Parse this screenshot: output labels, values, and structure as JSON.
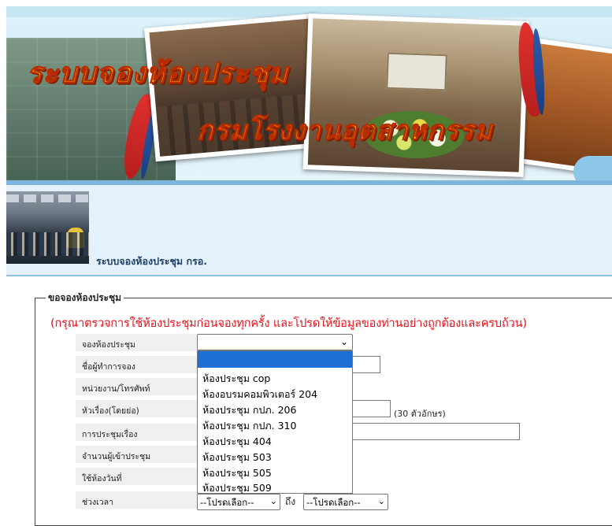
{
  "banner": {
    "title_line1": "ระบบจองห้องประชุม",
    "title_line2": "กรมโรงงานอุตสาหกรรม"
  },
  "header": {
    "system_title": "ระบบจองห้องประชุม กรอ."
  },
  "form": {
    "legend": "ขอจองห้องประชุม",
    "notice": "(กรุณาตรวจการใช้ห้องประชุมก่อนจองทุกครั้ง และโปรดให้ข้อมูลของท่านอย่างถูกต้องและครบถ้วน)",
    "labels": {
      "room": "จองห้องประชุม",
      "booker_name": "ชื่อผู้ทำการจอง",
      "department_phone": "หน่วยงาน/โทรศัพท์",
      "subject": "หัวเรื่อง(โดยย่อ)",
      "meeting_topic": "การประชุมเรื่อง",
      "attendees": "จำนวนผู้เข้าประชุม",
      "use_date": "ใช้ห้องวันที่",
      "time_range": "ช่วงเวลา"
    },
    "room_select": {
      "selected": "",
      "options": [
        "ห้องประชุม cop",
        "ห้องอบรมคอมพิวเตอร์ 204",
        "ห้องประชุม กปภ. 206",
        "ห้องประชุม กปภ. 310",
        "ห้องประชุม 404",
        "ห้องประชุม 503",
        "ห้องประชุม 505",
        "ห้องประชุม 509"
      ]
    },
    "subject_hint": "(30 ตัวอักษร)",
    "time_from": "--โปรดเลือก--",
    "time_to_label": "ถึง",
    "time_to": "--โปรดเลือก--"
  }
}
